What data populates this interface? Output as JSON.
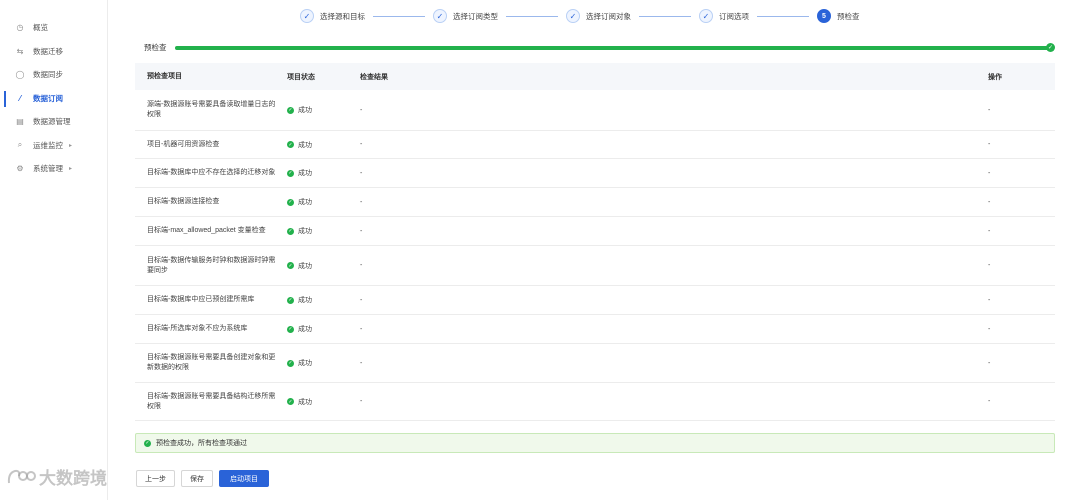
{
  "sidebar": {
    "items": [
      {
        "label": "概览",
        "icon": "dashboard-icon",
        "glyph": "◷"
      },
      {
        "label": "数据迁移",
        "icon": "migrate-icon",
        "glyph": "⇆"
      },
      {
        "label": "数据同步",
        "icon": "sync-icon",
        "glyph": "◯"
      },
      {
        "label": "数据订阅",
        "icon": "subscribe-icon",
        "glyph": "⁄"
      },
      {
        "label": "数据源管理",
        "icon": "datasource-icon",
        "glyph": "▤"
      },
      {
        "label": "运维监控",
        "icon": "monitor-icon",
        "glyph": "⌕",
        "has_submenu": true
      },
      {
        "label": "系统管理",
        "icon": "settings-icon",
        "glyph": "⚙",
        "has_submenu": true
      }
    ],
    "active_index": 3,
    "submenu_glyph": "▸"
  },
  "steps": [
    {
      "label": "选择源和目标",
      "state": "done",
      "glyph": "✓"
    },
    {
      "label": "选择订阅类型",
      "state": "done",
      "glyph": "✓"
    },
    {
      "label": "选择订阅对象",
      "state": "done",
      "glyph": "✓"
    },
    {
      "label": "订阅选项",
      "state": "done",
      "glyph": "✓"
    },
    {
      "label": "预检查",
      "state": "current",
      "number": "5"
    }
  ],
  "precheck": {
    "label": "预检查",
    "progress": 1.0
  },
  "table": {
    "headers": [
      "预检查项目",
      "项目状态",
      "检查结果",
      "操作"
    ],
    "rows": [
      {
        "item": "源端-数据源账号需要具备读取增量日志的权限",
        "status": "成功",
        "result": "-",
        "action": "-"
      },
      {
        "item": "项目-机器可用资源检查",
        "status": "成功",
        "result": "-",
        "action": "-"
      },
      {
        "item": "目标端-数据库中应不存在选择的迁移对象",
        "status": "成功",
        "result": "-",
        "action": "-"
      },
      {
        "item": "目标端-数据源连接检查",
        "status": "成功",
        "result": "-",
        "action": "-"
      },
      {
        "item": "目标端-max_allowed_packet 变量检查",
        "status": "成功",
        "result": "-",
        "action": "-"
      },
      {
        "item": "目标端-数据传输服务时钟和数据源时钟需要同步",
        "status": "成功",
        "result": "-",
        "action": "-"
      },
      {
        "item": "目标端-数据库中应已预创建所需库",
        "status": "成功",
        "result": "-",
        "action": "-"
      },
      {
        "item": "目标端-所选库对象不应为系统库",
        "status": "成功",
        "result": "-",
        "action": "-"
      },
      {
        "item": "目标端-数据源账号需要具备创建对象和更新数据的权限",
        "status": "成功",
        "result": "-",
        "action": "-"
      },
      {
        "item": "目标端-数据源账号需要具备结构迁移所需权限",
        "status": "成功",
        "result": "-",
        "action": "-"
      }
    ]
  },
  "banner": {
    "text": "预检查成功，所有检查项通过"
  },
  "buttons": {
    "prev": "上一步",
    "save": "保存",
    "start": "启动项目"
  },
  "watermark": {
    "text": "大数跨境"
  },
  "colors": {
    "primary": "#2a63d8",
    "success": "#22b14c",
    "success_bg": "#f0f9eb"
  }
}
